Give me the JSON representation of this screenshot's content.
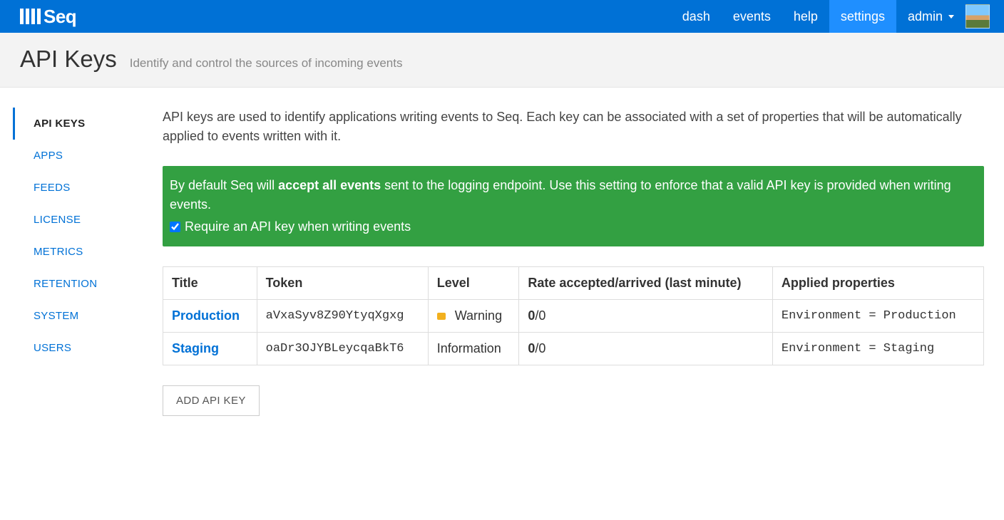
{
  "brand": "Seq",
  "nav": {
    "items": [
      {
        "label": "dash",
        "active": false
      },
      {
        "label": "events",
        "active": false
      },
      {
        "label": "help",
        "active": false
      },
      {
        "label": "settings",
        "active": true
      }
    ],
    "user": "admin"
  },
  "header": {
    "title": "API Keys",
    "subtitle": "Identify and control the sources of incoming events"
  },
  "sidebar": {
    "items": [
      {
        "label": "API KEYS",
        "active": true
      },
      {
        "label": "APPS",
        "active": false
      },
      {
        "label": "FEEDS",
        "active": false
      },
      {
        "label": "LICENSE",
        "active": false
      },
      {
        "label": "METRICS",
        "active": false
      },
      {
        "label": "RETENTION",
        "active": false
      },
      {
        "label": "SYSTEM",
        "active": false
      },
      {
        "label": "USERS",
        "active": false
      }
    ]
  },
  "content": {
    "intro": "API keys are used to identify applications writing events to Seq. Each key can be associated with a set of properties that will be automatically applied to events written with it.",
    "info_prefix": "By default Seq will ",
    "info_bold": "accept all events",
    "info_suffix": " sent to the logging endpoint. Use this setting to enforce that a valid API key is provided when writing events.",
    "require_checked": true,
    "require_label": "Require an API key when writing events",
    "table": {
      "headers": [
        "Title",
        "Token",
        "Level",
        "Rate accepted/arrived (last minute)",
        "Applied properties"
      ],
      "rows": [
        {
          "title": "Production",
          "token": "aVxaSyv8Z90YtyqXgxg",
          "level": "Warning",
          "level_color": "#f2b01e",
          "rate_accepted": "0",
          "rate_arrived": "0",
          "properties": "Environment = Production"
        },
        {
          "title": "Staging",
          "token": "oaDr3OJYBLeycqaBkT6",
          "level": "Information",
          "level_color": "",
          "rate_accepted": "0",
          "rate_arrived": "0",
          "properties": "Environment = Staging"
        }
      ]
    },
    "add_button": "ADD API KEY"
  }
}
